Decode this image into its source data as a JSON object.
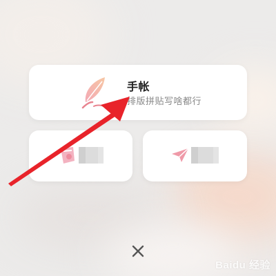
{
  "modal": {
    "main_option": {
      "title": "手帐",
      "subtitle": "排版拼贴写啥都行",
      "icon": "feather-quill-icon"
    },
    "left_option": {
      "icon": "pink-sticker-icon",
      "label_hidden": true
    },
    "right_option": {
      "icon": "pink-plane-icon",
      "label_hidden": true
    },
    "close": {
      "icon": "close-icon"
    }
  },
  "overlay": {
    "annotation": "red-arrow-annotation",
    "watermark": "Baidu 经验"
  },
  "colors": {
    "arrow": "#e8232a",
    "accent_pink": "#ee8c9e",
    "title_text": "#222222",
    "subtitle_text": "#888888"
  }
}
